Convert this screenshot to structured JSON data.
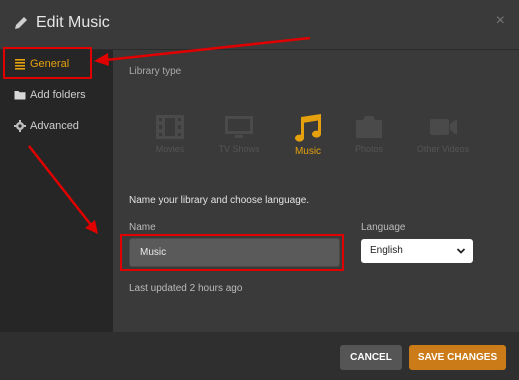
{
  "header": {
    "title": "Edit Music",
    "close_symbol": "×"
  },
  "sidebar": {
    "items": [
      {
        "label": "General",
        "icon": "list-icon",
        "active": true
      },
      {
        "label": "Add folders",
        "icon": "folder-icon",
        "active": false
      },
      {
        "label": "Advanced",
        "icon": "gear-icon",
        "active": false
      }
    ]
  },
  "main": {
    "library_type_label": "Library type",
    "types": [
      {
        "label": "Movies",
        "icon": "film-icon",
        "selected": false
      },
      {
        "label": "TV Shows",
        "icon": "tv-icon",
        "selected": false
      },
      {
        "label": "Music",
        "icon": "music-note-icon",
        "selected": true
      },
      {
        "label": "Photos",
        "icon": "camera-icon",
        "selected": false
      },
      {
        "label": "Other Videos",
        "icon": "video-camera-icon",
        "selected": false
      }
    ],
    "intro": "Name your library and choose language.",
    "name_label": "Name",
    "name_value": "Music",
    "language_label": "Language",
    "language_value": "English",
    "updated": "Last updated 2 hours ago"
  },
  "footer": {
    "cancel_label": "CANCEL",
    "save_label": "SAVE CHANGES"
  },
  "colors": {
    "accent": "#e5a00d",
    "save_button": "#cc7b19",
    "annotation": "#e00000"
  }
}
